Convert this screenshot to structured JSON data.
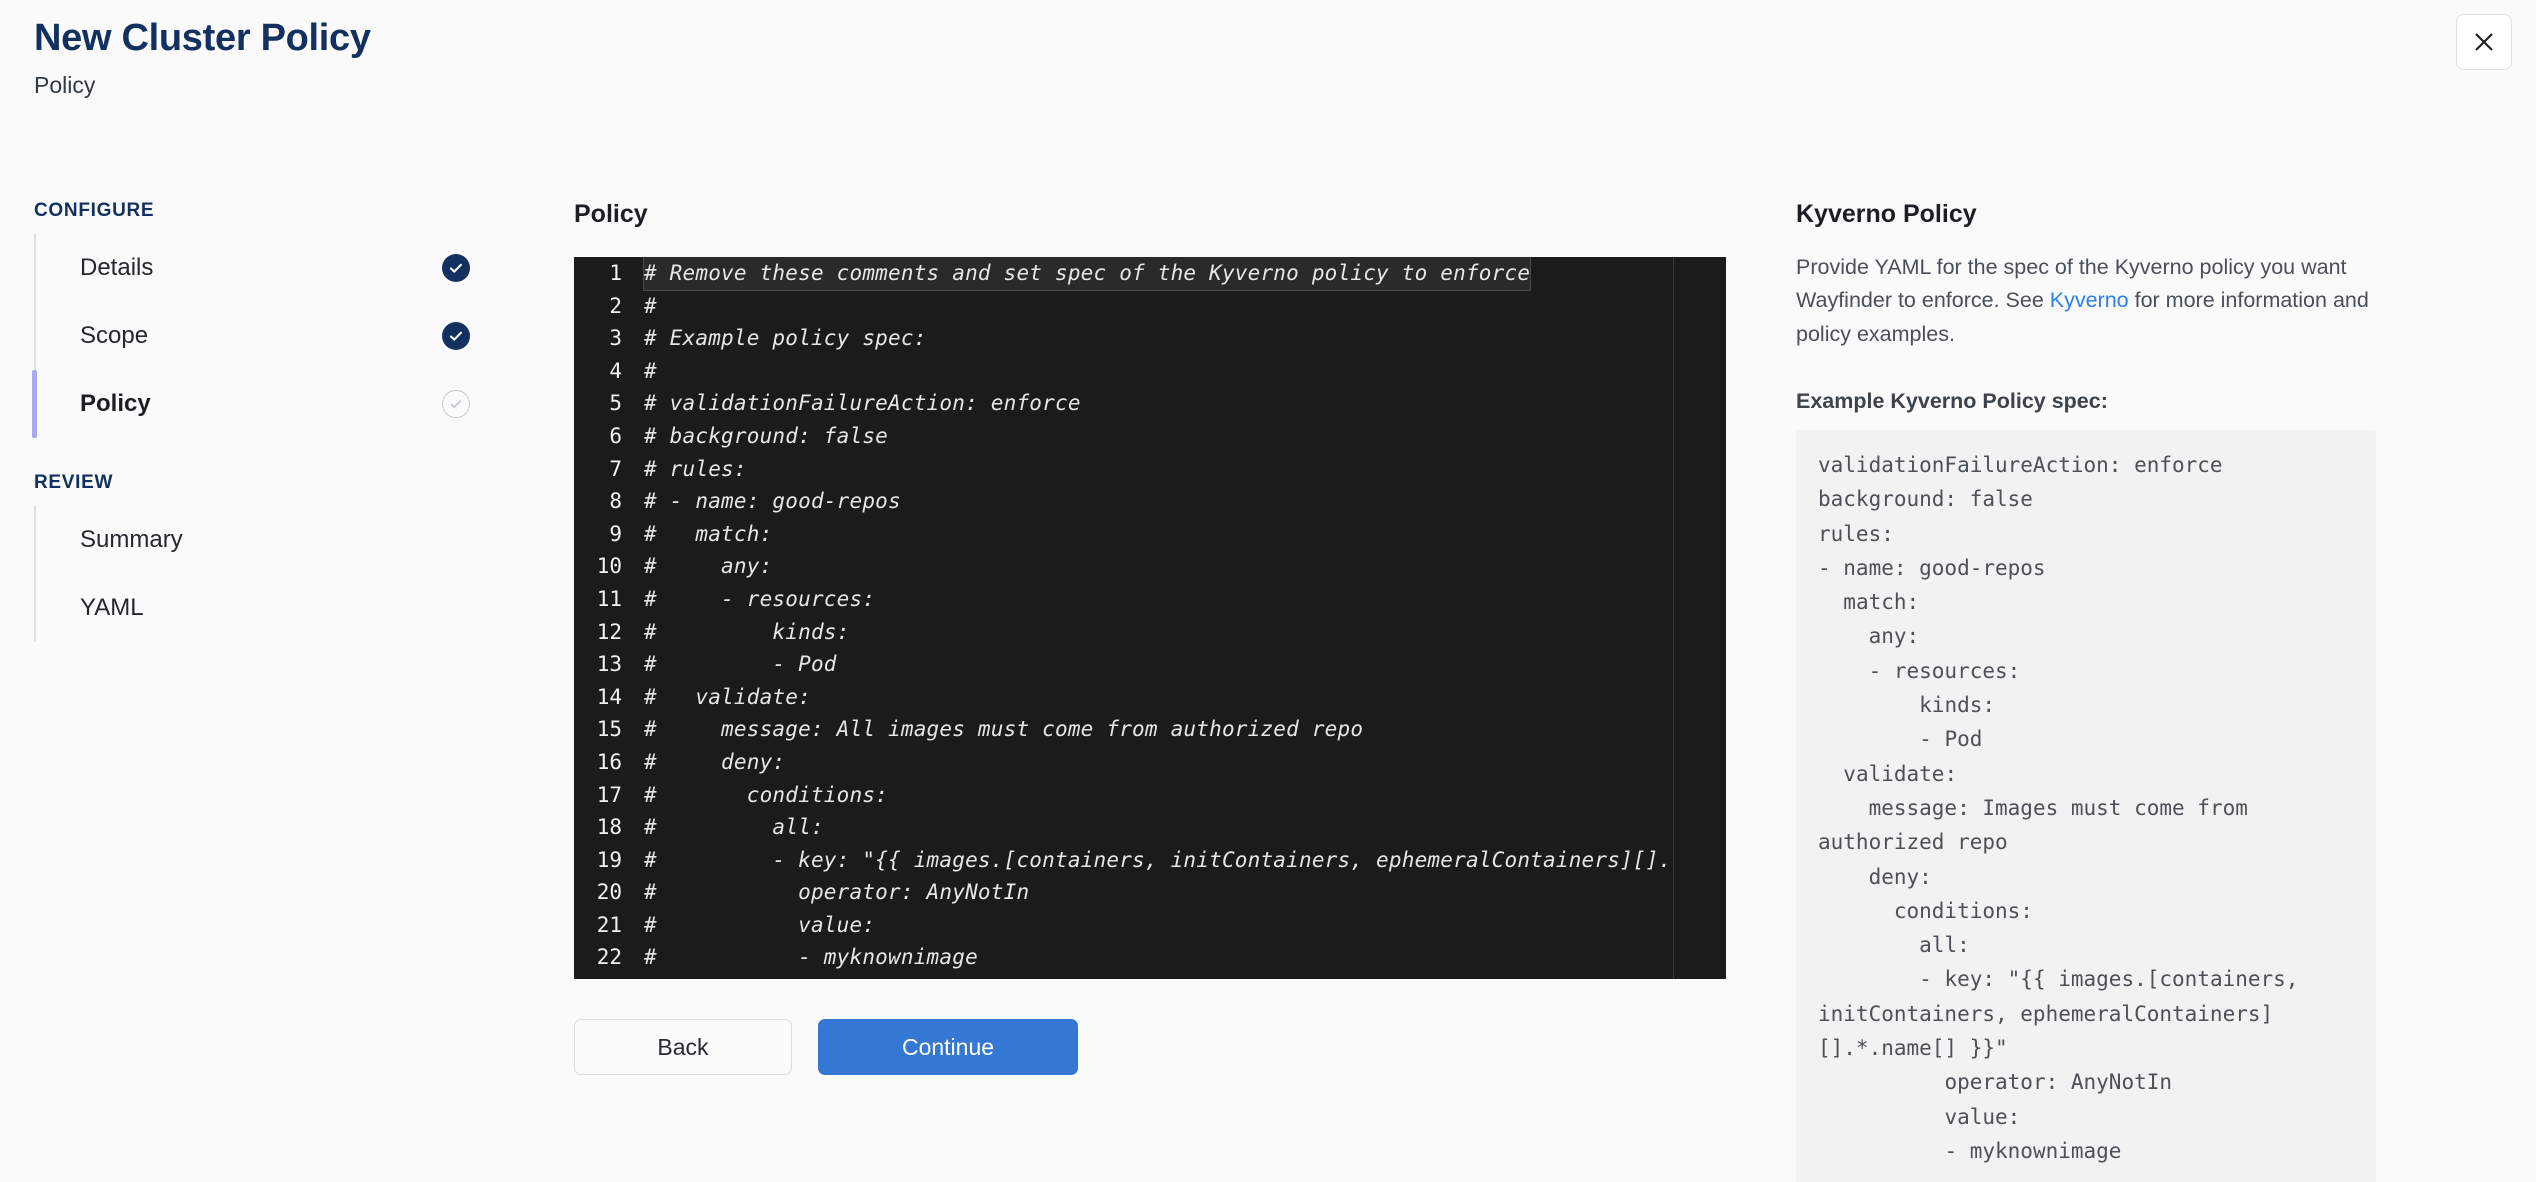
{
  "header": {
    "title": "New Cluster Policy",
    "subtitle": "Policy",
    "close_label": "close-icon"
  },
  "sidebar": {
    "configure_title": "CONFIGURE",
    "review_title": "REVIEW",
    "configure_items": [
      {
        "label": "Details",
        "state": "done"
      },
      {
        "label": "Scope",
        "state": "done"
      },
      {
        "label": "Policy",
        "state": "pending"
      }
    ],
    "review_items": [
      {
        "label": "Summary"
      },
      {
        "label": "YAML"
      }
    ]
  },
  "main": {
    "section_label": "Policy",
    "editor": {
      "lines": [
        {
          "n": "1",
          "text": "# Remove these comments and set spec of the Kyverno policy to enforce"
        },
        {
          "n": "2",
          "text": "#"
        },
        {
          "n": "3",
          "text": "# Example policy spec:"
        },
        {
          "n": "4",
          "text": "#"
        },
        {
          "n": "5",
          "text": "# validationFailureAction: enforce"
        },
        {
          "n": "6",
          "text": "# background: false"
        },
        {
          "n": "7",
          "text": "# rules:"
        },
        {
          "n": "8",
          "text": "# - name: good-repos"
        },
        {
          "n": "9",
          "text": "#   match:"
        },
        {
          "n": "10",
          "text": "#     any:"
        },
        {
          "n": "11",
          "text": "#     - resources:"
        },
        {
          "n": "12",
          "text": "#         kinds:"
        },
        {
          "n": "13",
          "text": "#         - Pod"
        },
        {
          "n": "14",
          "text": "#   validate:"
        },
        {
          "n": "15",
          "text": "#     message: All images must come from authorized repo"
        },
        {
          "n": "16",
          "text": "#     deny:"
        },
        {
          "n": "17",
          "text": "#       conditions:"
        },
        {
          "n": "18",
          "text": "#         all:"
        },
        {
          "n": "19",
          "text": "#         - key: \"{{ images.[containers, initContainers, ephemeralContainers][]."
        },
        {
          "n": "20",
          "text": "#           operator: AnyNotIn"
        },
        {
          "n": "21",
          "text": "#           value:"
        },
        {
          "n": "22",
          "text": "#           - myknownimage"
        }
      ],
      "highlighted_line": "1"
    },
    "buttons": {
      "back": "Back",
      "continue": "Continue"
    }
  },
  "right_panel": {
    "title": "Kyverno Policy",
    "desc_before": "Provide YAML for the spec of the Kyverno policy you want Wayfinder to enforce. See ",
    "link": "Kyverno",
    "desc_after": " for more information and policy examples.",
    "example_label": "Example Kyverno Policy spec:",
    "example_code": "validationFailureAction: enforce\nbackground: false\nrules:\n- name: good-repos\n  match:\n    any:\n    - resources:\n        kinds:\n        - Pod\n  validate:\n    message: Images must come from authorized repo\n    deny:\n      conditions:\n        all:\n        - key: \"{{ images.[containers, initContainers, ephemeralContainers][].*.name[] }}\"\n          operator: AnyNotIn\n          value:\n          - myknownimage"
  },
  "colors": {
    "brand_navy": "#123160",
    "accent_blue": "#3478d4",
    "link_blue": "#2d7ff0",
    "active_bar": "#a9a8f0",
    "editor_bg": "#1b1b1b"
  }
}
